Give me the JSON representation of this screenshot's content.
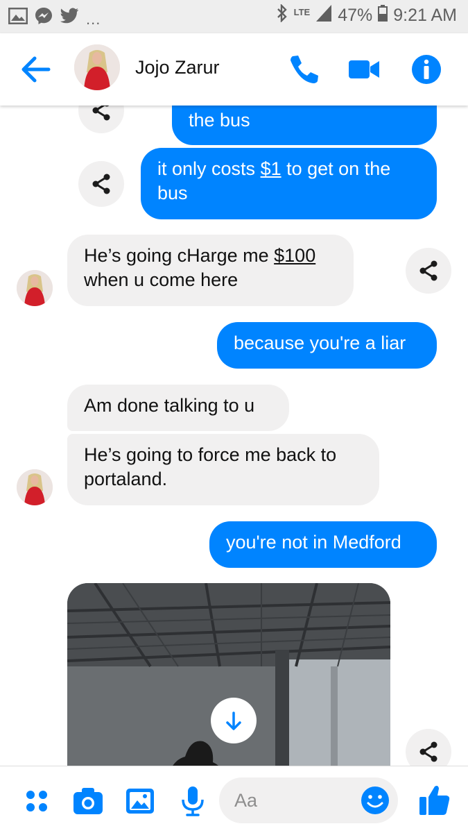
{
  "status_bar": {
    "network": "LTE",
    "battery": "47%",
    "time": "9:21 AM",
    "more": "...",
    "icons": [
      "gallery-icon",
      "messenger-icon",
      "twitter-icon",
      "bluetooth-icon",
      "signal-icon",
      "battery-icon"
    ]
  },
  "header": {
    "contact_name": "Jojo Zarur",
    "icons": [
      "back-arrow-icon",
      "phone-icon",
      "video-camera-icon",
      "info-icon"
    ]
  },
  "messages": [
    {
      "side": "out",
      "parts": [
        {
          "t": "the bus"
        }
      ]
    },
    {
      "side": "out",
      "parts": [
        {
          "t": "it only costs "
        },
        {
          "t": "$1",
          "u": true
        },
        {
          "t": " to get on the bus"
        }
      ]
    },
    {
      "side": "in",
      "parts": [
        {
          "t": "He’s going cHarge me "
        },
        {
          "t": "$100",
          "u": true
        },
        {
          "t": " when u come here"
        }
      ]
    },
    {
      "side": "out",
      "parts": [
        {
          "t": "because you're a liar"
        }
      ]
    },
    {
      "side": "in",
      "parts": [
        {
          "t": "Am done talking to u"
        }
      ]
    },
    {
      "side": "in",
      "parts": [
        {
          "t": "He’s going to force me back to portaland."
        }
      ]
    },
    {
      "side": "out",
      "parts": [
        {
          "t": "you're not in Medford"
        }
      ]
    }
  ],
  "composer": {
    "placeholder": "Aa",
    "icons": [
      "more-icon",
      "camera-icon",
      "gallery-icon",
      "microphone-icon",
      "emoji-icon",
      "thumbs-up-icon"
    ]
  },
  "colors": {
    "accent": "#0084ff",
    "incoming_bubble": "#f1f0f0",
    "status_bar": "#eeeeee"
  }
}
